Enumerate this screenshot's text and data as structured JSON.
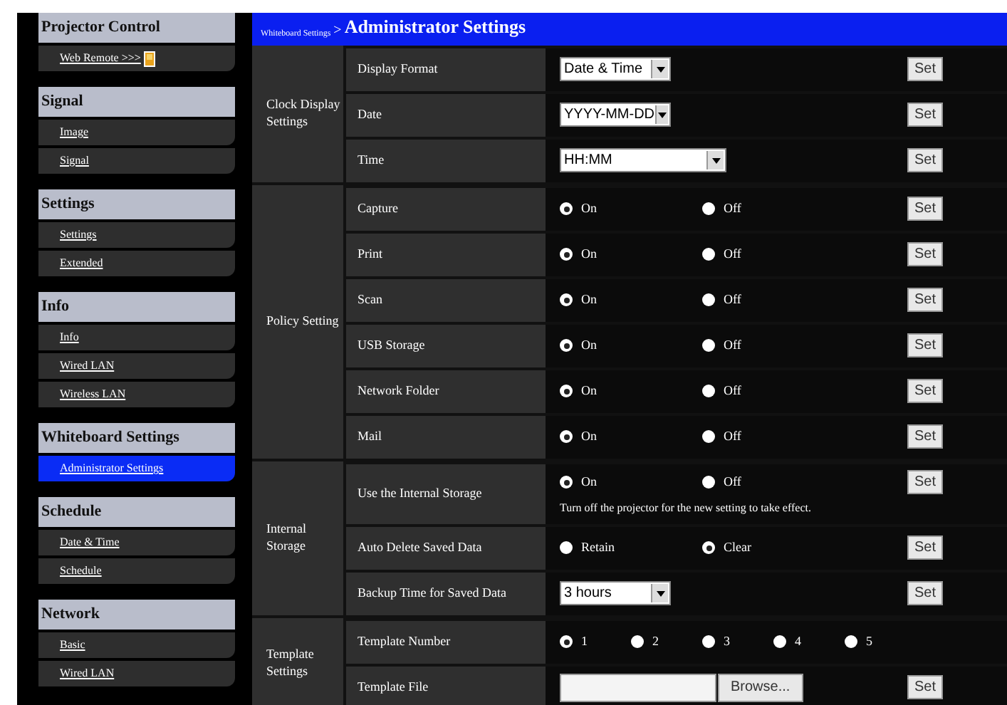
{
  "sidebar": {
    "sections": [
      {
        "title": "Projector Control",
        "items": [
          {
            "label": "Web Remote >>>",
            "selected": false,
            "kind": "external"
          }
        ]
      },
      {
        "title": "Signal",
        "items": [
          {
            "label": "Image",
            "selected": false
          },
          {
            "label": "Signal",
            "selected": false
          }
        ]
      },
      {
        "title": "Settings",
        "items": [
          {
            "label": "Settings",
            "selected": false
          },
          {
            "label": "Extended",
            "selected": false
          }
        ]
      },
      {
        "title": "Info",
        "items": [
          {
            "label": "Info",
            "selected": false
          },
          {
            "label": "Wired LAN",
            "selected": false
          },
          {
            "label": "Wireless LAN",
            "selected": false
          }
        ]
      },
      {
        "title": "Whiteboard Settings",
        "items": [
          {
            "label": "Administrator Settings",
            "selected": true
          }
        ]
      },
      {
        "title": "Schedule",
        "items": [
          {
            "label": "Date & Time",
            "selected": false
          },
          {
            "label": "Schedule",
            "selected": false
          }
        ]
      },
      {
        "title": "Network",
        "items": [
          {
            "label": "Basic",
            "selected": false
          },
          {
            "label": "Wired LAN",
            "selected": false
          }
        ]
      }
    ]
  },
  "breadcrumb": {
    "parent": "Whiteboard Settings",
    "separator": ">",
    "title": "Administrator Settings"
  },
  "groups": [
    {
      "label": "Clock Display Settings",
      "rows": [
        {
          "label": "Display Format",
          "kind": "select",
          "value": "Date & Time",
          "wide": false,
          "set": "Set"
        },
        {
          "label": "Date",
          "kind": "select",
          "value": "YYYY-MM-DD",
          "wide": false,
          "set": "Set"
        },
        {
          "label": "Time",
          "kind": "select",
          "value": "HH:MM",
          "wide": true,
          "set": "Set"
        }
      ]
    },
    {
      "label": "Policy Setting",
      "rows": [
        {
          "label": "Capture",
          "kind": "radio",
          "options": [
            {
              "label": "On",
              "selected": true
            },
            {
              "label": "Off",
              "selected": false
            }
          ],
          "set": "Set"
        },
        {
          "label": "Print",
          "kind": "radio",
          "options": [
            {
              "label": "On",
              "selected": true
            },
            {
              "label": "Off",
              "selected": false
            }
          ],
          "set": "Set"
        },
        {
          "label": "Scan",
          "kind": "radio",
          "options": [
            {
              "label": "On",
              "selected": true
            },
            {
              "label": "Off",
              "selected": false
            }
          ],
          "set": "Set"
        },
        {
          "label": "USB Storage",
          "kind": "radio",
          "options": [
            {
              "label": "On",
              "selected": true
            },
            {
              "label": "Off",
              "selected": false
            }
          ],
          "set": "Set"
        },
        {
          "label": "Network Folder",
          "kind": "radio",
          "options": [
            {
              "label": "On",
              "selected": true
            },
            {
              "label": "Off",
              "selected": false
            }
          ],
          "set": "Set"
        },
        {
          "label": "Mail",
          "kind": "radio",
          "options": [
            {
              "label": "On",
              "selected": true
            },
            {
              "label": "Off",
              "selected": false
            }
          ],
          "set": "Set"
        }
      ]
    },
    {
      "label": "Internal Storage",
      "rows": [
        {
          "label": "Use the Internal Storage",
          "kind": "radio",
          "options": [
            {
              "label": "On",
              "selected": true
            },
            {
              "label": "Off",
              "selected": false
            }
          ],
          "note": "Turn off the projector for the new setting to take effect.",
          "set": "Set"
        },
        {
          "label": "Auto Delete Saved Data",
          "kind": "radio",
          "options": [
            {
              "label": "Retain",
              "selected": false
            },
            {
              "label": "Clear",
              "selected": true
            }
          ],
          "set": "Set"
        },
        {
          "label": "Backup Time for Saved Data",
          "kind": "select",
          "value": "3 hours",
          "wide": false,
          "set": "Set"
        }
      ]
    },
    {
      "label": "Template Settings",
      "rows": [
        {
          "label": "Template Number",
          "kind": "radio",
          "options": [
            {
              "label": "1",
              "selected": true
            },
            {
              "label": "2",
              "selected": false
            },
            {
              "label": "3",
              "selected": false
            },
            {
              "label": "4",
              "selected": false
            },
            {
              "label": "5",
              "selected": false
            }
          ]
        },
        {
          "label": "Template File",
          "kind": "file",
          "button": "Browse...",
          "set": "Set"
        }
      ]
    }
  ]
}
